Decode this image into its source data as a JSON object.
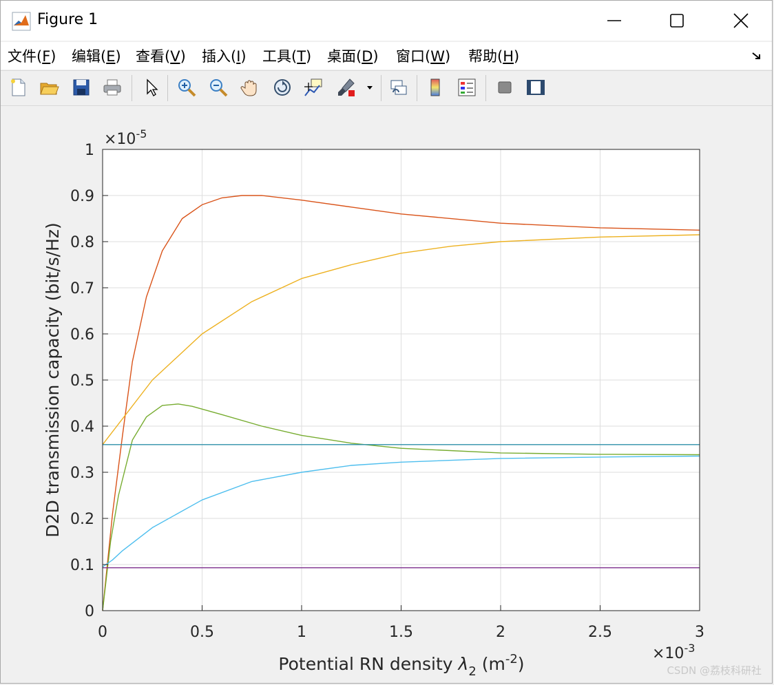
{
  "window": {
    "title": "Figure 1",
    "menu": [
      "文件(F)",
      "编辑(E)",
      "查看(V)",
      "插入(I)",
      "工具(T)",
      "桌面(D)",
      "窗口(W)",
      "帮助(H)"
    ],
    "menu_keys": [
      "F",
      "E",
      "V",
      "I",
      "T",
      "D",
      "W",
      "H"
    ],
    "toolbar_icons": [
      "new-figure-icon",
      "open-file-icon",
      "save-icon",
      "print-icon",
      "edit-pointer-icon",
      "zoom-in-icon",
      "zoom-out-icon",
      "pan-icon",
      "rotate-3d-icon",
      "data-cursor-icon",
      "brush-icon",
      "link-plot-icon",
      "colorbar-icon",
      "legend-icon",
      "hide-plot-tools-icon",
      "show-plot-tools-icon"
    ]
  },
  "watermark": "CSDN @荔枝科研社",
  "colors": {
    "red": "#D95319",
    "yellow": "#EDB120",
    "green": "#77AC30",
    "teal": "#2B8FA8",
    "cyan": "#4DBEEE",
    "purple": "#7E2F8E"
  },
  "chart_data": {
    "type": "line",
    "xlabel": "Potential RN density λ2 (m-2)",
    "xlabel_parts": {
      "main": "Potential RN density ",
      "symbol": "λ",
      "sub": "2",
      "unit_open": " (m",
      "sup": "-2",
      "unit_close": ")"
    },
    "ylabel": "D2D transmission capacity (bit/s/Hz)",
    "x_exponent_label": "×10",
    "x_exponent": "-3",
    "y_exponent_label": "×10",
    "y_exponent": "-5",
    "xlim": [
      0,
      3
    ],
    "ylim": [
      0,
      1
    ],
    "xticks": [
      0,
      0.5,
      1,
      1.5,
      2,
      2.5,
      3
    ],
    "xtick_labels": [
      "0",
      "0.5",
      "1",
      "1.5",
      "2",
      "2.5",
      "3"
    ],
    "yticks": [
      0,
      0.1,
      0.2,
      0.3,
      0.4,
      0.5,
      0.6,
      0.7,
      0.8,
      0.9,
      1
    ],
    "ytick_labels": [
      "0",
      "0.1",
      "0.2",
      "0.3",
      "0.4",
      "0.5",
      "0.6",
      "0.7",
      "0.8",
      "0.9",
      "1"
    ],
    "grid": true,
    "series": [
      {
        "color_key": "red",
        "x": [
          0,
          0.05,
          0.1,
          0.15,
          0.22,
          0.3,
          0.4,
          0.5,
          0.6,
          0.7,
          0.8,
          1.0,
          1.25,
          1.5,
          2.0,
          2.5,
          3.0
        ],
        "y": [
          0,
          0.21,
          0.38,
          0.54,
          0.68,
          0.78,
          0.85,
          0.88,
          0.895,
          0.9,
          0.9,
          0.89,
          0.875,
          0.86,
          0.84,
          0.83,
          0.825
        ]
      },
      {
        "color_key": "yellow",
        "x": [
          0,
          0.25,
          0.5,
          0.75,
          1.0,
          1.25,
          1.5,
          1.75,
          2.0,
          2.5,
          3.0
        ],
        "y": [
          0.36,
          0.5,
          0.6,
          0.67,
          0.72,
          0.75,
          0.775,
          0.79,
          0.8,
          0.81,
          0.815
        ]
      },
      {
        "color_key": "green",
        "x": [
          0,
          0.04,
          0.08,
          0.15,
          0.22,
          0.3,
          0.38,
          0.45,
          0.6,
          0.8,
          1.0,
          1.25,
          1.5,
          2.0,
          2.5,
          3.0
        ],
        "y": [
          0,
          0.15,
          0.25,
          0.37,
          0.42,
          0.445,
          0.448,
          0.443,
          0.425,
          0.4,
          0.38,
          0.363,
          0.352,
          0.342,
          0.339,
          0.338
        ]
      },
      {
        "color_key": "teal",
        "x": [
          0,
          3.0
        ],
        "y": [
          0.36,
          0.36
        ]
      },
      {
        "color_key": "cyan",
        "x": [
          0,
          0.05,
          0.1,
          0.25,
          0.5,
          0.75,
          1.0,
          1.25,
          1.5,
          2.0,
          2.5,
          3.0
        ],
        "y": [
          0.095,
          0.11,
          0.13,
          0.18,
          0.24,
          0.28,
          0.3,
          0.315,
          0.322,
          0.33,
          0.333,
          0.335
        ]
      },
      {
        "color_key": "purple",
        "x": [
          0,
          3.0
        ],
        "y": [
          0.093,
          0.093
        ]
      }
    ]
  }
}
